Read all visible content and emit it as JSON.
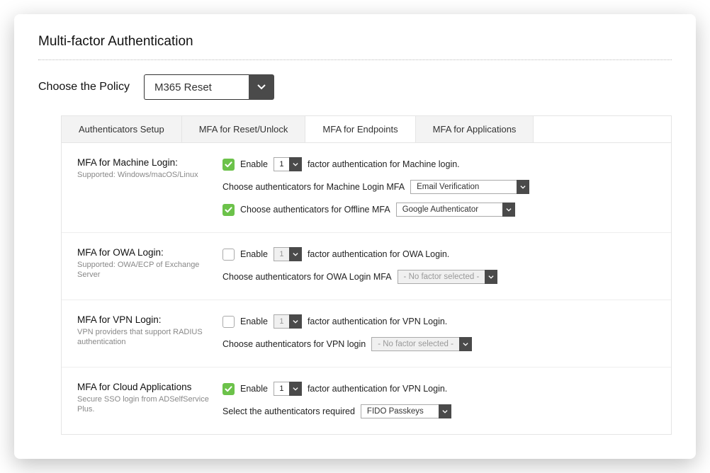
{
  "title": "Multi-factor Authentication",
  "policy": {
    "label": "Choose the Policy",
    "value": "M365 Reset"
  },
  "tabs": [
    {
      "label": "Authenticators Setup",
      "active": false
    },
    {
      "label": "MFA for Reset/Unlock",
      "active": false
    },
    {
      "label": "MFA for Endpoints",
      "active": true
    },
    {
      "label": "MFA for Applications",
      "active": false
    }
  ],
  "sections": {
    "machine": {
      "title": "MFA for Machine Login:",
      "desc": "Supported: Windows/macOS/Linux",
      "enable_label": "Enable",
      "enable_checked": true,
      "factor_count": "1",
      "factor_text": "factor authentication for Machine login.",
      "row2_label": "Choose authenticators for Machine Login MFA",
      "row2_value": "Email Verification",
      "row3_checked": true,
      "row3_label": "Choose authenticators for Offline MFA",
      "row3_value": "Google Authenticator"
    },
    "owa": {
      "title": "MFA for OWA Login:",
      "desc": "Supported: OWA/ECP of Exchange Server",
      "enable_label": "Enable",
      "enable_checked": false,
      "factor_count": "1",
      "factor_text": "factor authentication for OWA Login.",
      "row2_label": "Choose authenticators for OWA Login MFA",
      "row2_value": "- No factor selected -"
    },
    "vpn": {
      "title": "MFA for VPN Login:",
      "desc": "VPN providers that support RADIUS authentication",
      "enable_label": "Enable",
      "enable_checked": false,
      "factor_count": "1",
      "factor_text": "factor authentication for VPN Login.",
      "row2_label": "Choose authenticators for VPN login",
      "row2_value": "- No factor selected -"
    },
    "cloud": {
      "title": "MFA for Cloud Applications",
      "desc": "Secure SSO login from ADSelfService Plus.",
      "enable_label": "Enable",
      "enable_checked": true,
      "factor_count": "1",
      "factor_text": "factor authentication for VPN Login.",
      "row2_label": "Select the authenticators required",
      "row2_value": "FIDO Passkeys"
    }
  }
}
